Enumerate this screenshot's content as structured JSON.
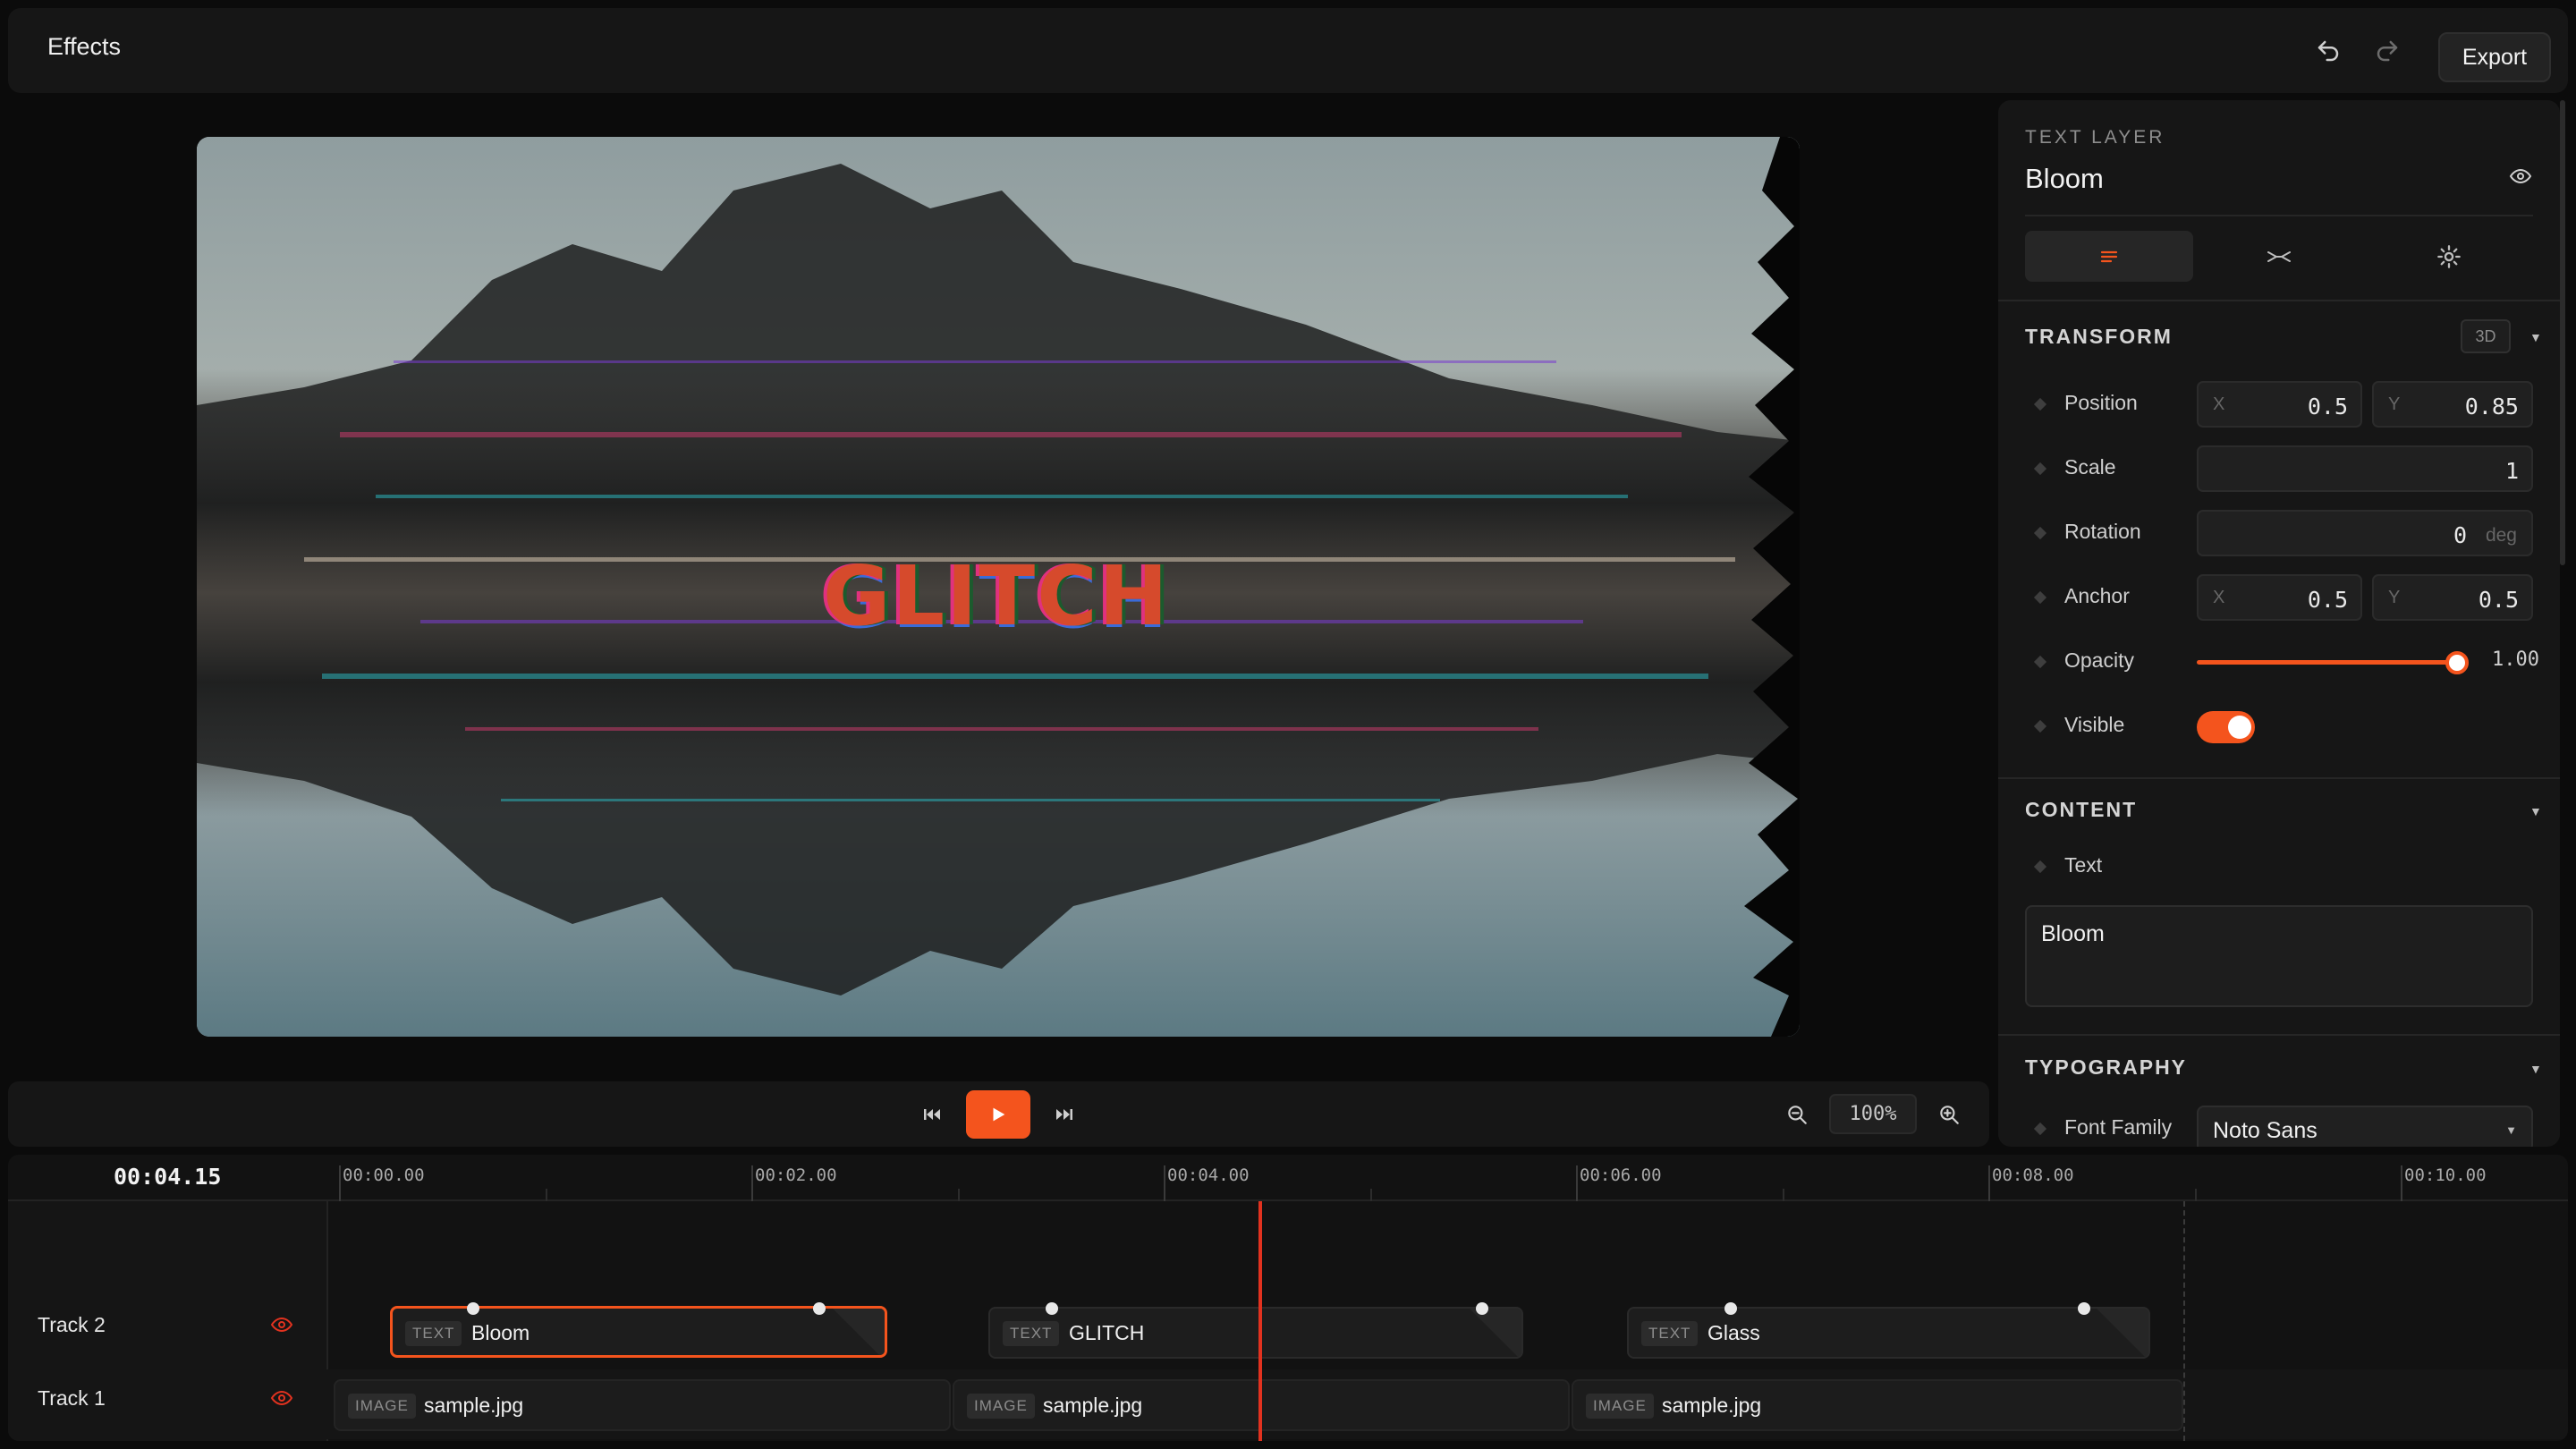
{
  "header": {
    "title": "Effects",
    "export_label": "Export",
    "undo_icon": "undo-icon",
    "redo_icon": "redo-icon"
  },
  "preview": {
    "overlay_text": "GLITCH",
    "image": "glitched landscape with trees reflected in water"
  },
  "transport": {
    "zoom_level": "100%"
  },
  "inspector": {
    "kicker": "TEXT LAYER",
    "layer_name": "Bloom",
    "tabs": [
      "text-align-icon",
      "effects-icon",
      "settings-icon"
    ],
    "transform": {
      "title": "TRANSFORM",
      "badge": "3D",
      "position_label": "Position",
      "position_x_axis": "X",
      "position_x": "0.5",
      "position_y_axis": "Y",
      "position_y": "0.85",
      "scale_label": "Scale",
      "scale": "1",
      "rotation_label": "Rotation",
      "rotation": "0",
      "rotation_unit": "deg",
      "anchor_label": "Anchor",
      "anchor_x_axis": "X",
      "anchor_x": "0.5",
      "anchor_y_axis": "Y",
      "anchor_y": "0.5",
      "opacity_label": "Opacity",
      "opacity": "1.00",
      "opacity_value": 1.0,
      "visible_label": "Visible",
      "visible": true
    },
    "content": {
      "title": "CONTENT",
      "text_label": "Text",
      "text_value": "Bloom"
    },
    "typography": {
      "title": "TYPOGRAPHY",
      "font_family_label": "Font Family",
      "font_family": "Noto Sans"
    }
  },
  "timeline": {
    "current_time": "00:04.15",
    "ruler": [
      "00:00.00",
      "00:02.00",
      "00:04.00",
      "00:06.00",
      "00:08.00",
      "00:10.00"
    ],
    "tracks": [
      {
        "name": "Track 2",
        "clips": [
          {
            "type": "TEXT",
            "name": "Bloom",
            "selected": true
          },
          {
            "type": "TEXT",
            "name": "GLITCH",
            "selected": false
          },
          {
            "type": "TEXT",
            "name": "Glass",
            "selected": false
          }
        ]
      },
      {
        "name": "Track 1",
        "clips": [
          {
            "type": "IMAGE",
            "name": "sample.jpg"
          },
          {
            "type": "IMAGE",
            "name": "sample.jpg"
          },
          {
            "type": "IMAGE",
            "name": "sample.jpg"
          }
        ]
      }
    ]
  },
  "colors": {
    "accent": "#f4541d",
    "playhead": "#e2321f",
    "panel": "#161616",
    "background": "#0b0b0b"
  }
}
